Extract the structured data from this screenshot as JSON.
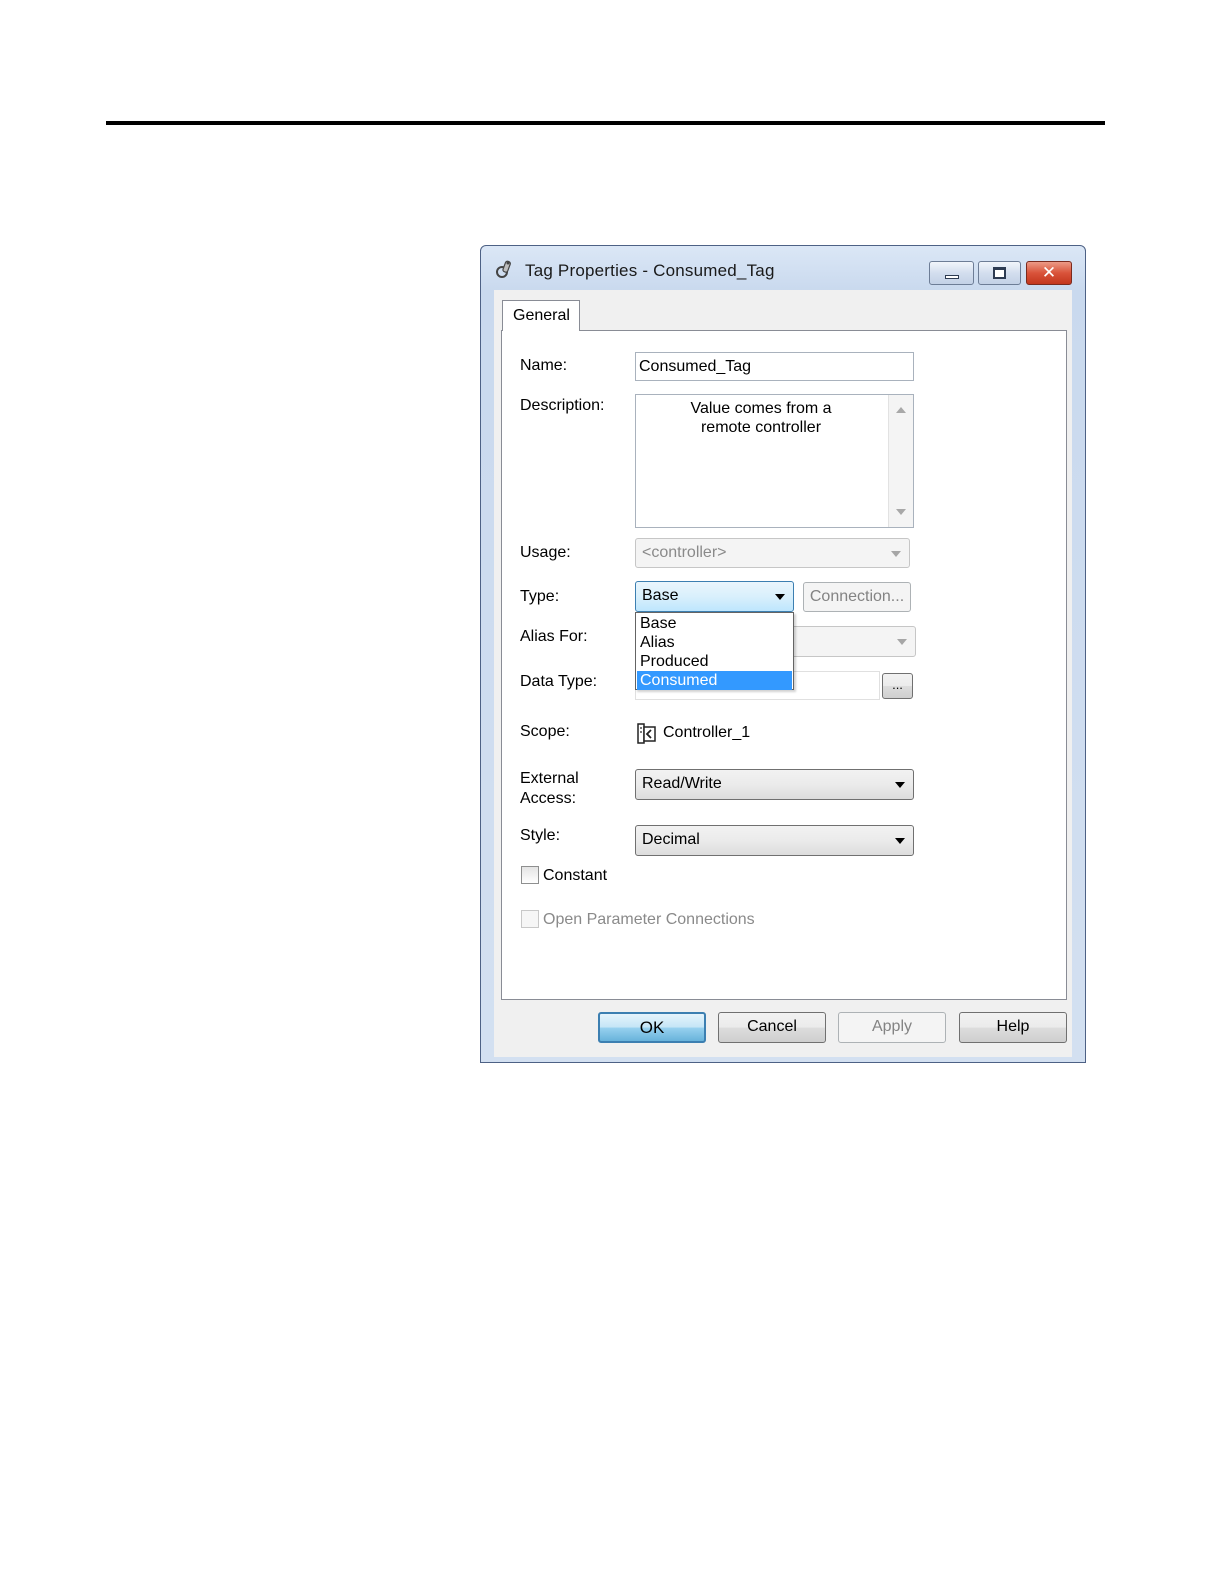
{
  "window": {
    "title": "Tag Properties - Consumed_Tag",
    "caption_buttons": {
      "minimize": "minimize-icon",
      "maximize": "maximize-icon",
      "close": "✕"
    }
  },
  "tabs": [
    {
      "label": "General",
      "active": true
    }
  ],
  "form": {
    "name": {
      "label": "Name:",
      "value": "Consumed_Tag"
    },
    "description": {
      "label": "Description:",
      "value": "Value comes from a\nremote controller"
    },
    "usage": {
      "label": "Usage:",
      "value": "<controller>"
    },
    "type": {
      "label": "Type:",
      "value": "Base",
      "options": [
        "Base",
        "Alias",
        "Produced",
        "Consumed"
      ],
      "highlighted": "Consumed",
      "connection_button": "Connection..."
    },
    "alias_for": {
      "label": "Alias For:",
      "value": ""
    },
    "data_type": {
      "label": "Data Type:",
      "value": "",
      "browse_button": "..."
    },
    "scope": {
      "label": "Scope:",
      "value": "Controller_1",
      "icon": "controller-icon"
    },
    "external_access": {
      "label_line1": "External",
      "label_line2": "Access:",
      "value": "Read/Write"
    },
    "style": {
      "label": "Style:",
      "value": "Decimal"
    },
    "constant": {
      "label": "Constant",
      "checked": false
    },
    "open_parameter_connections": {
      "label": "Open Parameter Connections",
      "checked": false,
      "enabled": false
    }
  },
  "buttons": {
    "ok": "OK",
    "cancel": "Cancel",
    "apply": "Apply",
    "help": "Help"
  },
  "colors": {
    "selection": "#3399ff",
    "default_button_border": "#3c7fb1",
    "close_button": "#c3361d"
  }
}
